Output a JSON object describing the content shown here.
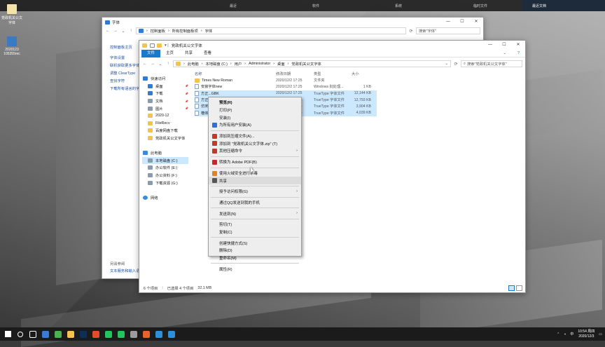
{
  "topbar": {
    "items": [
      "最近",
      "软件",
      "系统",
      "临时文件"
    ],
    "recent": "最近文档"
  },
  "desktop": {
    "icons": [
      {
        "label": "党政机关公文字体",
        "icon": "folder-doc-icon"
      },
      {
        "label": "2020123 105355rec",
        "icon": "image-file-icon"
      }
    ]
  },
  "back_window": {
    "title": "字体",
    "address": [
      "控制面板",
      "所有控制面板项",
      "字体"
    ],
    "search_placeholder": "搜索\"字体\"",
    "sidebar": [
      "控制面板主页",
      "字体设置",
      "联机获取更多字体",
      "调整 ClearType",
      "查找字符",
      "下载所有语言的字"
    ],
    "see_also": "另请参阅",
    "see_also_link": "文本服务和输入语"
  },
  "front_window": {
    "title": "党政机关公文字体",
    "ribbon_tabs": [
      "文件",
      "主页",
      "共享",
      "查看"
    ],
    "address": [
      "此电脑",
      "本地磁盘 (C:)",
      "用户",
      "Administrator",
      "桌面",
      "党政机关公文字体"
    ],
    "search_placeholder": "搜索\"党政机关公文字体\"",
    "nav": [
      {
        "label": "快速访问",
        "icon": "star-icon",
        "indent": 0
      },
      {
        "label": "桌面",
        "icon": "desktop-icon",
        "indent": 1,
        "pin": true
      },
      {
        "label": "下载",
        "icon": "download-icon",
        "indent": 1,
        "pin": true
      },
      {
        "label": "文档",
        "icon": "documents-icon",
        "indent": 1,
        "pin": true
      },
      {
        "label": "图片",
        "icon": "pictures-icon",
        "indent": 1,
        "pin": true
      },
      {
        "label": "2020-12",
        "icon": "folder-icon",
        "indent": 1
      },
      {
        "label": "FileRecv",
        "icon": "folder-icon",
        "indent": 1
      },
      {
        "label": "百度网盘下载",
        "icon": "folder-icon",
        "indent": 1
      },
      {
        "label": "党政机关公文字体",
        "icon": "folder-icon",
        "indent": 1
      },
      {
        "label": "",
        "icon": "",
        "indent": 0
      },
      {
        "label": "此电脑",
        "icon": "pc-icon",
        "indent": 0
      },
      {
        "label": "本地磁盘 (C:)",
        "icon": "drive-icon",
        "indent": 1,
        "selected": true
      },
      {
        "label": "办公软件 (E:)",
        "icon": "drive-icon",
        "indent": 1
      },
      {
        "label": "办公资料 (F:)",
        "icon": "drive-icon",
        "indent": 1
      },
      {
        "label": "下载资源 (G:)",
        "icon": "drive-icon",
        "indent": 1
      },
      {
        "label": "",
        "icon": "",
        "indent": 0
      },
      {
        "label": "网络",
        "icon": "network-icon",
        "indent": 0
      }
    ],
    "columns": {
      "name": "名称",
      "date": "修改日期",
      "type": "类型",
      "size": "大小"
    },
    "files": [
      {
        "name": "Times New Roman",
        "date": "2020/12/2 17:25",
        "type": "文件夹",
        "size": "",
        "selected": false
      },
      {
        "name": "安装字体new",
        "date": "2020/12/2 17:25",
        "type": "Windows 批处理...",
        "size": "1 KB",
        "selected": false
      },
      {
        "name": "方正...GBK",
        "date": "2020/12/2 17:25",
        "type": "TrueType 字体文件",
        "size": "12,144 KB",
        "selected": true
      },
      {
        "name": "方正...",
        "date": "2020/12/2 17:25",
        "type": "TrueType 字体文件",
        "size": "12,793 KB",
        "selected": true
      },
      {
        "name": "仿宋...",
        "date": "2020/12/2 17:25",
        "type": "TrueType 字体文件",
        "size": "3,904 KB",
        "selected": true
      },
      {
        "name": "楷体...",
        "date": "2020/12/2 17:25",
        "type": "TrueType 字体文件",
        "size": "4,039 KB",
        "selected": true
      }
    ],
    "status": {
      "count": "6 个项目",
      "selected": "已选择 4 个项目",
      "size": "32.1 MB"
    }
  },
  "context_menu": [
    {
      "label": "预览(R)",
      "bold": true
    },
    {
      "label": "打印(P)"
    },
    {
      "label": "安装(I)"
    },
    {
      "label": "为所有用户安装(A)",
      "icon": "shield-icon"
    },
    {
      "sep": true
    },
    {
      "label": "添加到压缩文件(A)...",
      "icon": "archive-icon"
    },
    {
      "label": "添加到 \"党政机关公文字体.zip\" (T)",
      "icon": "archive-icon"
    },
    {
      "label": "其他压缩命令",
      "icon": "archive-icon",
      "arrow": true
    },
    {
      "sep": true
    },
    {
      "label": "转换为 Adobe PDF(B)",
      "icon": "pdf-icon"
    },
    {
      "sep": true
    },
    {
      "label": "使用火绒安全进行杀毒",
      "icon": "antivirus-icon"
    },
    {
      "label": "共享",
      "icon": "share-icon",
      "hover": true
    },
    {
      "sep": true
    },
    {
      "label": "授予访问权限(G)",
      "arrow": true
    },
    {
      "sep": true
    },
    {
      "label": "通过QQ发送到我的手机"
    },
    {
      "sep": true
    },
    {
      "label": "发送到(N)",
      "arrow": true
    },
    {
      "sep": true
    },
    {
      "label": "剪切(T)"
    },
    {
      "label": "复制(C)"
    },
    {
      "sep": true
    },
    {
      "label": "创建快捷方式(S)"
    },
    {
      "label": "删除(D)"
    },
    {
      "label": "重命名(M)"
    },
    {
      "sep": true
    },
    {
      "label": "属性(R)"
    }
  ],
  "taskbar": {
    "time": "10:54 周四",
    "date": "2020/12/3",
    "icons": [
      "start-icon",
      "search-icon",
      "task-view-icon",
      "browser-icon",
      "chrome-icon",
      "explorer-icon",
      "photoshop-icon",
      "app-icon",
      "wechat-icon",
      "wechat-icon",
      "media-icon",
      "office-icon",
      "mail-icon",
      "desktop-icon"
    ],
    "colors": [
      "#ffffff",
      "#ffffff",
      "#ffffff",
      "#3b7bd6",
      "#4caf50",
      "#f3c34e",
      "#0c2f5a",
      "#e24b2c",
      "#23c45e",
      "#23c45e",
      "#9c9c9c",
      "#e8622e",
      "#2e8fd6",
      "#2e8fd6"
    ]
  }
}
